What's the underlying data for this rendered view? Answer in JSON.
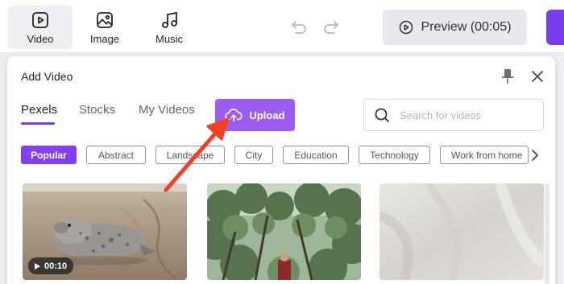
{
  "toolbar": {
    "tools": [
      {
        "label": "Video",
        "icon": "video-icon"
      },
      {
        "label": "Image",
        "icon": "image-icon"
      },
      {
        "label": "Music",
        "icon": "music-icon"
      }
    ],
    "preview_label": "Preview (00:05)"
  },
  "panel": {
    "title": "Add Video",
    "tabs": [
      {
        "label": "Pexels",
        "active": true
      },
      {
        "label": "Stocks",
        "active": false
      },
      {
        "label": "My Videos",
        "active": false
      }
    ],
    "upload_label": "Upload",
    "search": {
      "placeholder": "Search for videos"
    },
    "categories": [
      {
        "label": "Popular",
        "active": true
      },
      {
        "label": "Abstract"
      },
      {
        "label": "Landscape"
      },
      {
        "label": "City"
      },
      {
        "label": "Education"
      },
      {
        "label": "Technology"
      },
      {
        "label": "Work from home"
      }
    ],
    "videos": [
      {
        "duration": "00:10",
        "subject": "seal on beach"
      },
      {
        "subject": "person among trees"
      },
      {
        "subject": "white fabric"
      }
    ]
  },
  "colors": {
    "accent": "#7b3cf0",
    "upload": "#9c5cf0",
    "annotation_arrow": "#f0402a"
  }
}
